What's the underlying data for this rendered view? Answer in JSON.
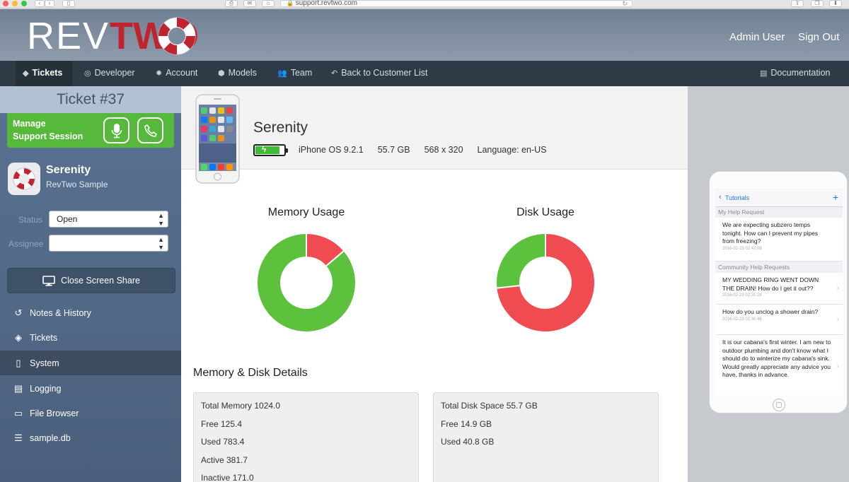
{
  "browser": {
    "url": "support.revtwo.com"
  },
  "header": {
    "logo_rev": "REV",
    "logo_two": "TWO",
    "user_name": "Admin User",
    "sign_out": "Sign Out"
  },
  "nav": {
    "tickets": "Tickets",
    "developer": "Developer",
    "account": "Account",
    "models": "Models",
    "team": "Team",
    "back": "Back to Customer List",
    "documentation": "Documentation"
  },
  "sidebar": {
    "ticket_title": "Ticket #37",
    "manage_line1": "Manage",
    "manage_line2": "Support Session",
    "device_name": "Serenity",
    "device_app": "RevTwo Sample",
    "status_label": "Status",
    "status_value": "Open",
    "assignee_label": "Assignee",
    "assignee_value": "",
    "share_button": "Close Screen Share",
    "items": [
      {
        "label": "Notes & History"
      },
      {
        "label": "Tickets"
      },
      {
        "label": "System"
      },
      {
        "label": "Logging"
      },
      {
        "label": "File Browser"
      },
      {
        "label": "sample.db"
      }
    ]
  },
  "device": {
    "name": "Serenity",
    "os": "iPhone OS 9.2.1",
    "storage": "55.7 GB",
    "resolution": "568 x 320",
    "language": "Language: en-US",
    "battery_level": 0.85
  },
  "chart_data": [
    {
      "type": "pie",
      "title": "Memory Usage",
      "labels": [
        "Free",
        "Used"
      ],
      "values": [
        125.4,
        783.4
      ],
      "colors": [
        "#ef4b51",
        "#5cc23d"
      ]
    },
    {
      "type": "pie",
      "title": "Disk Usage",
      "labels": [
        "Used",
        "Free"
      ],
      "values": [
        40.8,
        14.9
      ],
      "colors": [
        "#ef4b51",
        "#5cc23d"
      ]
    }
  ],
  "details": {
    "title": "Memory & Disk Details",
    "memory": [
      "Total Memory 1024.0",
      "Free 125.4",
      "Used 783.4",
      "Active 381.7",
      "Inactive 171.0"
    ],
    "disk": [
      "Total Disk Space 55.7 GB",
      "Free 14.9 GB",
      "Used 40.8 GB"
    ]
  },
  "mirror": {
    "back_label": "Tutorials",
    "add_label": "+",
    "section1": "My Help Request",
    "request_text": "We are expecting subzero temps tonight.  How can I prevent my pipes from freezing?",
    "request_date": "2016-02-23 02:47:08",
    "section2": "Community Help Requests",
    "community": [
      {
        "text": "MY WEDDING RING WENT DOWN THE DRAIN!  How do I get it out??",
        "date": "2016-02-23 02:31:28"
      },
      {
        "text": "How do you unclog a shower drain?",
        "date": "2016-02-23 02:30:46"
      },
      {
        "text": "It is our cabana's first winter.  I am new to outdoor plumbing and don't know what I should do to winterize my cabana's sink.  Would greatly appreciate any advice you have, thanks in advance.",
        "date": ""
      }
    ]
  }
}
